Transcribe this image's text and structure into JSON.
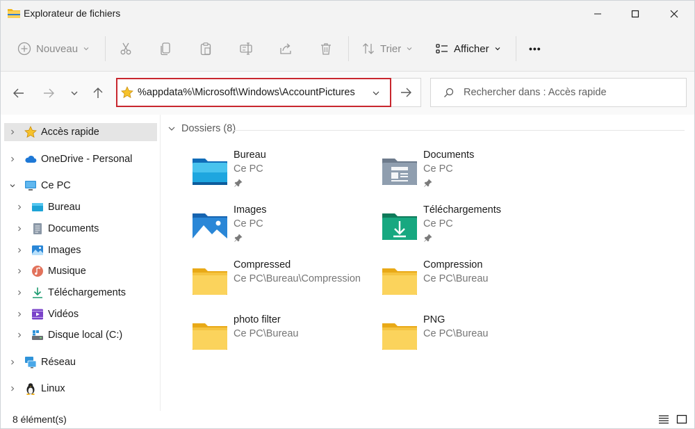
{
  "window": {
    "title": "Explorateur de fichiers"
  },
  "toolbar": {
    "new_label": "Nouveau",
    "sort_label": "Trier",
    "view_label": "Afficher",
    "more_label": "•••"
  },
  "address": {
    "path": "%appdata%\\Microsoft\\Windows\\AccountPictures",
    "search_placeholder": "Rechercher dans : Accès rapide"
  },
  "sidebar": {
    "items": [
      {
        "label": "Accès rapide",
        "icon": "star-icon"
      },
      {
        "label": "OneDrive - Personal",
        "icon": "cloud-icon"
      },
      {
        "label": "Ce PC",
        "icon": "monitor-icon"
      },
      {
        "label": "Bureau",
        "icon": "desktop-icon"
      },
      {
        "label": "Documents",
        "icon": "document-icon"
      },
      {
        "label": "Images",
        "icon": "image-icon"
      },
      {
        "label": "Musique",
        "icon": "music-icon"
      },
      {
        "label": "Téléchargements",
        "icon": "download-icon"
      },
      {
        "label": "Vidéos",
        "icon": "video-icon"
      },
      {
        "label": "Disque local (C:)",
        "icon": "drive-icon"
      },
      {
        "label": "Réseau",
        "icon": "network-icon"
      },
      {
        "label": "Linux",
        "icon": "penguin-icon"
      }
    ]
  },
  "content": {
    "group_label": "Dossiers (8)",
    "folders": [
      {
        "name": "Bureau",
        "location": "Ce PC",
        "pinned": true,
        "icon": "desktop-folder-icon"
      },
      {
        "name": "Documents",
        "location": "Ce PC",
        "pinned": true,
        "icon": "documents-folder-icon"
      },
      {
        "name": "Images",
        "location": "Ce PC",
        "pinned": true,
        "icon": "images-folder-icon"
      },
      {
        "name": "Téléchargements",
        "location": "Ce PC",
        "pinned": true,
        "icon": "downloads-folder-icon"
      },
      {
        "name": "Compressed",
        "location": "Ce PC\\Bureau\\Compression",
        "pinned": false,
        "icon": "folder-icon"
      },
      {
        "name": "Compression",
        "location": "Ce PC\\Bureau",
        "pinned": false,
        "icon": "folder-icon"
      },
      {
        "name": "photo filter",
        "location": "Ce PC\\Bureau",
        "pinned": false,
        "icon": "folder-icon"
      },
      {
        "name": "PNG",
        "location": "Ce PC\\Bureau",
        "pinned": false,
        "icon": "folder-icon"
      }
    ]
  },
  "status": {
    "count_text": "8 élément(s)"
  },
  "colors": {
    "accent_red": "#c8262e",
    "folder_yellow": "#f8c93c",
    "blue": "#0078d4"
  }
}
